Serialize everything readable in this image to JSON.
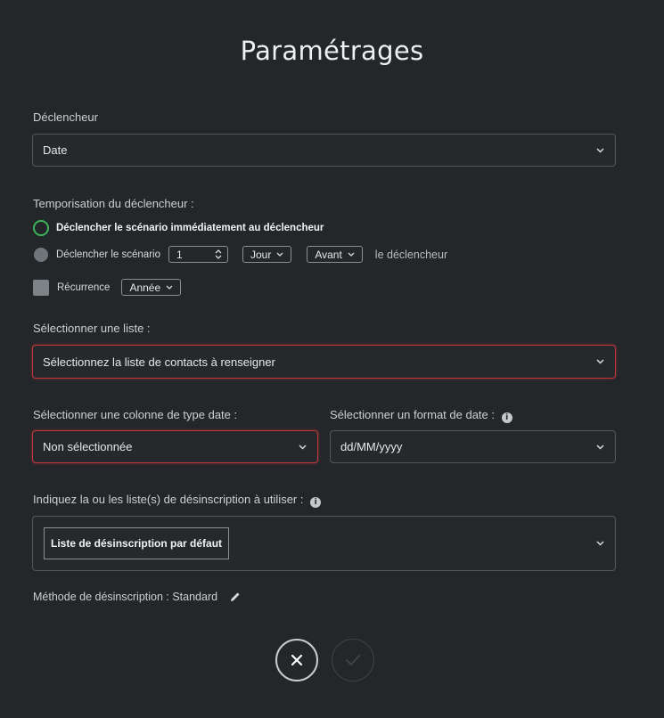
{
  "title": "Paramétrages",
  "trigger": {
    "label": "Déclencheur",
    "value": "Date"
  },
  "timing": {
    "label": "Temporisation du déclencheur :",
    "option_immediate": "Déclencher le scénario immédiatement au déclencheur",
    "option_delayed": "Déclencher le scénario",
    "delay_value": "1",
    "unit": "Jour",
    "direction": "Avant",
    "suffix": "le déclencheur",
    "recurrence_label": "Récurrence",
    "recurrence_value": "Année"
  },
  "list": {
    "label": "Sélectionner une liste :",
    "placeholder": "Sélectionnez la liste de contacts à renseigner"
  },
  "date_column": {
    "label": "Sélectionner une colonne de type date :",
    "value": "Non sélectionnée"
  },
  "date_format": {
    "label": "Sélectionner un format de date :",
    "value": "dd/MM/yyyy"
  },
  "unsubscribe": {
    "label": "Indiquez la ou les liste(s) de désinscription à utiliser :",
    "tag": "Liste de désinscription par défaut",
    "method": "Méthode de désinscription : Standard"
  },
  "actions": {
    "close_icon": "close-icon",
    "confirm_icon": "check-icon"
  },
  "colors": {
    "background": "#23272a",
    "accent_green": "#3fb05a",
    "error_red": "#c0393f"
  }
}
